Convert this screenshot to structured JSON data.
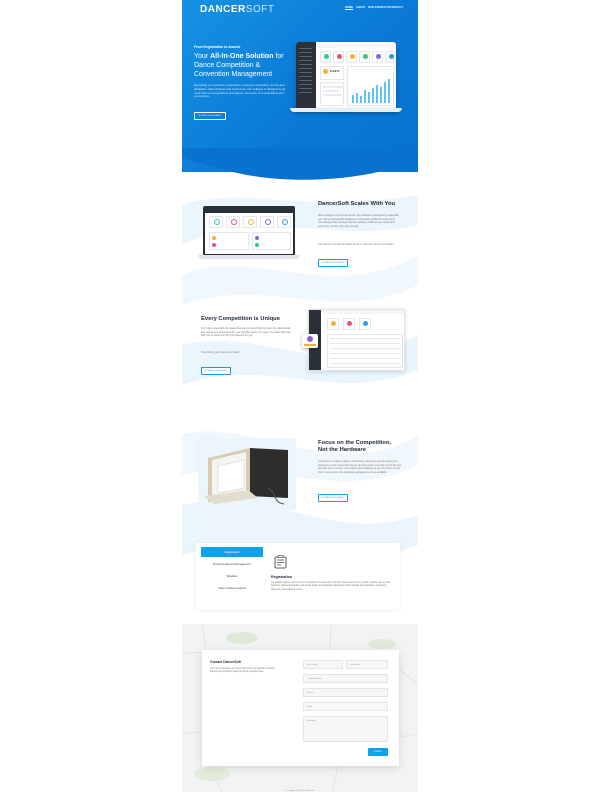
{
  "brand": {
    "logo_main": "DANCER",
    "logo_soft": "SOFT"
  },
  "nav": {
    "items": [
      "HOME",
      "ABOUT",
      "OUR PRODUCTS",
      "CONTACT"
    ]
  },
  "hero": {
    "eyebrow": "From Registration to Awards",
    "headline_pre": "Your ",
    "headline_strong": "All-In-One Solution",
    "headline_post": " for Dance Competition & Convention Management",
    "body_a": "Everything you need from registration, employee scheduling, scoring and tabulation, video critiques and much more. Our software is designed to do more than run competitions and classes, and more, for",
    "body_b": "competitions and conventions.",
    "cta": "SCHEDULE A DEMO",
    "dash_kpi": "$ 9,870"
  },
  "scales": {
    "title": "DancerSoft Scales With You",
    "body": "Start a single event or 100 events. Our software is designed to scale with you. We've built specific features to incorporate all facets of the event. You choose what you want and the software molds to your needs and your team, not the other way around.",
    "body2": "Give dancers an almost instant score, in real time, 90 per cent faster.",
    "cta": "SCHEDULE A DEMO"
  },
  "unique": {
    "title": "Every Competition is Unique",
    "body": "Don't get to deal with the hassle that you do everything by hand. Our dashboards and reports are customized for your specific needs. Our team of experts will work with you to determine the right features for you.",
    "body2": "Your timing, your rules, your brand.",
    "cta": "SCHEDULE A DEMO"
  },
  "hardware": {
    "title_line1": "Focus on the Competition,",
    "title_line2": "Not the Hardware",
    "body": "Computers, monitors, tablets, connections, and more can be sourced to maximum results. Event kits are set up and ready to run right out of the box. We take care of setup, tech support, and shipping so you can focus on the show. Ask us about the hardware packages we have available.",
    "cta": "SCHEDULE A DEMO"
  },
  "tabs": {
    "items": [
      "Registration",
      "Employee/Event Management",
      "Tabulator",
      "Video Critique Capture"
    ],
    "active_index": 0,
    "panel_title": "Registration",
    "panel_body": "Let studios register online for any competition or convention you host. Keep track of every studio, routine, dancer and payment. Upload schedules and results easily. All registration information flows straight into tabulation, eliminating data entry and reducing errors."
  },
  "contact": {
    "title": "Contact DancerSoft",
    "body": "Get more of answers to how to help you in competition or dance training. Get solutions ready for things just like these.",
    "fields": {
      "first_name": "First Name",
      "last_name": "Last Name",
      "company": "Company Name",
      "phone": "Phone",
      "email": "Email",
      "message": "Message"
    },
    "submit": "SUBMIT"
  },
  "footer": {
    "text": "© Copyright 2019 DancerSoft, Inc."
  },
  "colors": {
    "hero_blue": "#0a7ad6",
    "accent": "#10a2e9",
    "dark": "#1c2733"
  },
  "icons": {
    "tab_panel": "registration-form-icon"
  }
}
